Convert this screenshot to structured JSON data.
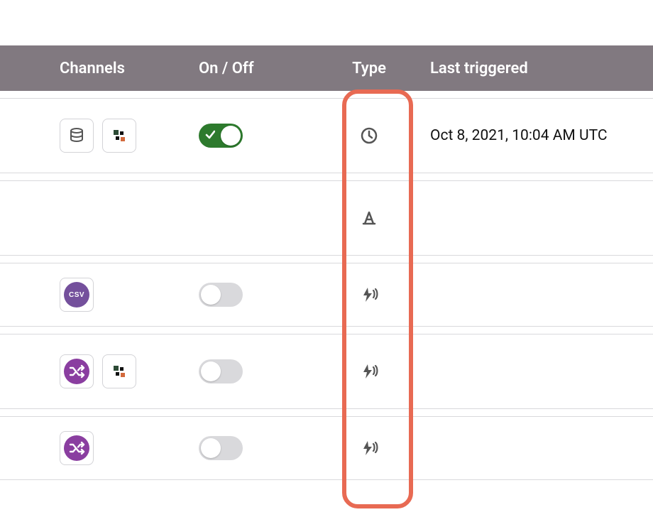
{
  "columns": {
    "channels": "Channels",
    "onoff": "On / Off",
    "type": "Type",
    "last_triggered": "Last triggered"
  },
  "rows": [
    {
      "channels": [
        "database",
        "pixel"
      ],
      "enabled": true,
      "type": "clock",
      "last_triggered": "Oct 8, 2021, 10:04 AM UTC"
    },
    {
      "channels": [],
      "enabled": null,
      "type": "construction",
      "last_triggered": ""
    },
    {
      "channels": [
        "csv"
      ],
      "enabled": false,
      "type": "broadcast",
      "last_triggered": ""
    },
    {
      "channels": [
        "shuffle",
        "pixel"
      ],
      "enabled": false,
      "type": "broadcast",
      "last_triggered": ""
    },
    {
      "channels": [
        "shuffle"
      ],
      "enabled": false,
      "type": "broadcast",
      "last_triggered": ""
    }
  ],
  "icons": {
    "csv_label": "CSV"
  }
}
